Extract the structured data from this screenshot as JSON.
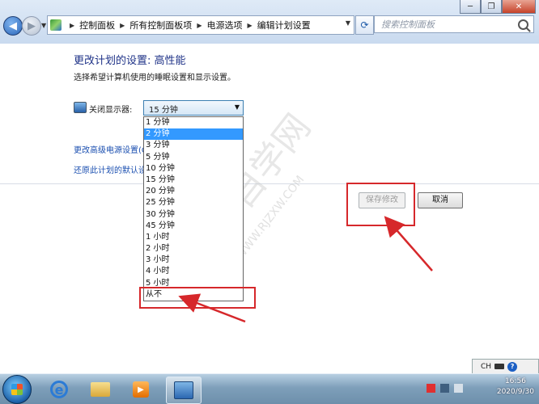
{
  "window": {
    "min_label": "─",
    "max_label": "❐",
    "close_label": "✕"
  },
  "address": {
    "breadcrumbs": [
      "控制面板",
      "所有控制面板项",
      "电源选项",
      "编辑计划设置"
    ],
    "search_placeholder": "搜索控制面板"
  },
  "content": {
    "title": "更改计划的设置: 高性能",
    "subtitle": "选择希望计算机使用的睡眠设置和显示设置。",
    "display_off_label": "关闭显示器:",
    "display_off_value": "15 分钟",
    "advanced_link": "更改高级电源设置(C)",
    "restore_link": "还原此计划的默认设置"
  },
  "dropdown": {
    "options": [
      "1 分钟",
      "2 分钟",
      "3 分钟",
      "5 分钟",
      "10 分钟",
      "15 分钟",
      "20 分钟",
      "25 分钟",
      "30 分钟",
      "45 分钟",
      "1 小时",
      "2 小时",
      "3 小时",
      "4 小时",
      "5 小时",
      "从不"
    ],
    "highlighted": "2 分钟"
  },
  "buttons": {
    "save": "保存修改",
    "cancel": "取消"
  },
  "taskbar": {
    "language": "CH",
    "time": "16:56",
    "date": "2020/9/30"
  },
  "watermark": {
    "text_cn": "软件自学网",
    "text_url": "WWW.RJZXW.COM"
  },
  "colors": {
    "accent_title": "#1e3287",
    "link": "#1b4fb0",
    "selection": "#3399ff",
    "annotation_red": "#d6282b"
  }
}
